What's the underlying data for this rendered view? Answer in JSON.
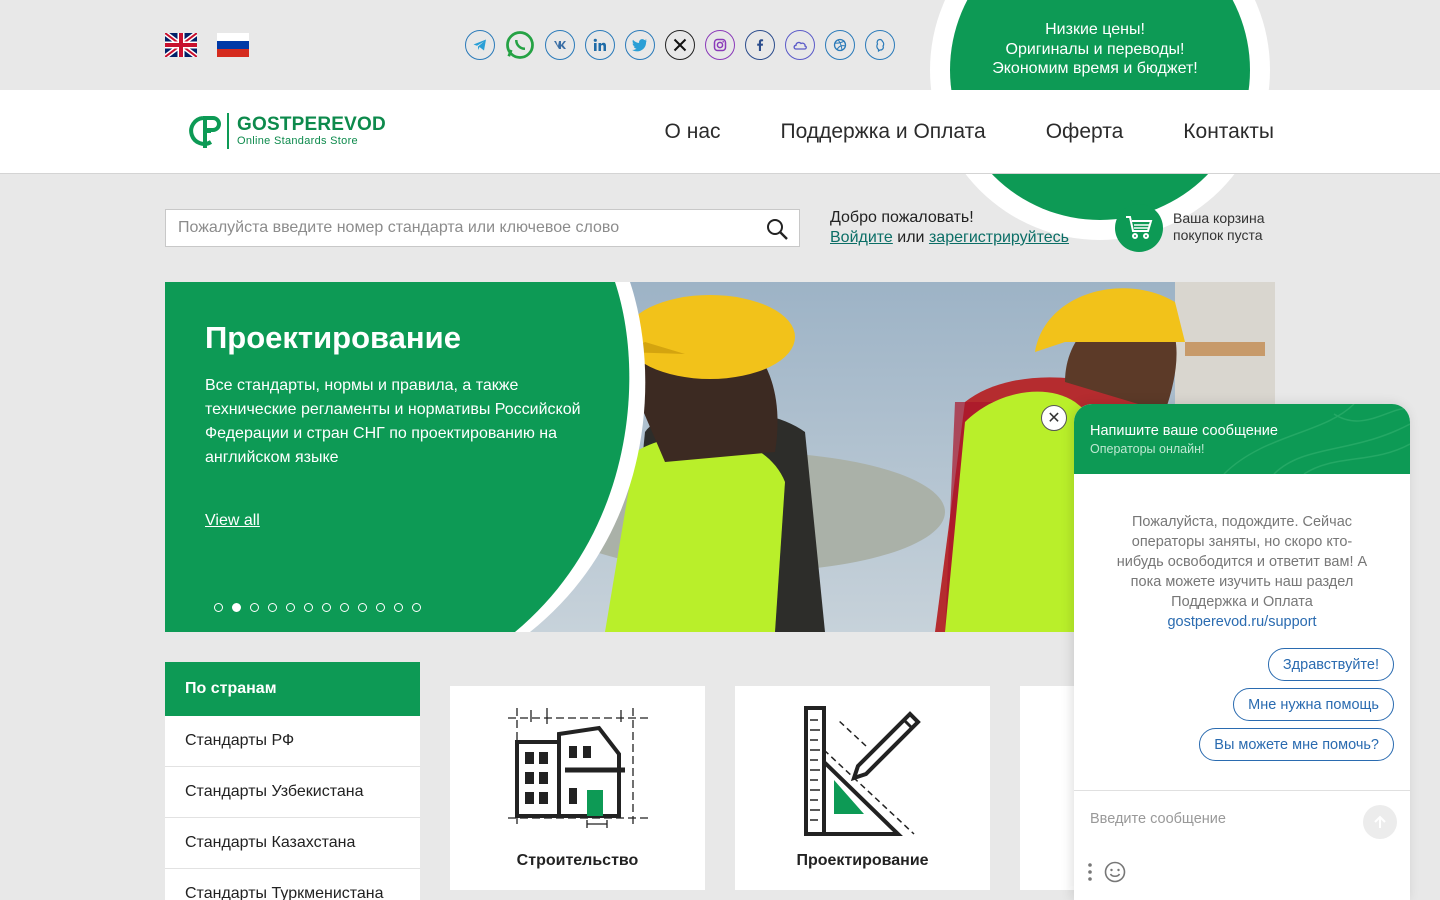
{
  "topbar": {
    "languages": [
      "English",
      "Русский"
    ],
    "socials": [
      "telegram",
      "whatsapp",
      "vk",
      "linkedin",
      "twitter",
      "x",
      "instagram",
      "facebook",
      "cloud",
      "dribbble",
      "messenger"
    ],
    "promo": {
      "line1": "Низкие цены!",
      "line2": "Оригиналы и переводы!",
      "line3": "Экономим время и бюджет!"
    }
  },
  "header": {
    "logo_name": "GOSTPEREVOD",
    "logo_sub": "Online Standards Store",
    "nav": [
      "О нас",
      "Поддержка и Оплата",
      "Оферта",
      "Контакты"
    ]
  },
  "search": {
    "placeholder": "Пожалуйста введите номер стандарта или ключевое слово",
    "value": ""
  },
  "account": {
    "welcome": "Добро пожаловать!",
    "login": "Войдите",
    "or": "или",
    "register": "зарегистрируйтесь"
  },
  "cart": {
    "line1": "Ваша корзина",
    "line2": "покупок пуста"
  },
  "hero": {
    "title": "Проектирование",
    "description": "Все стандарты, нормы и правила, а также технические регламенты и нормативы Российской Федерации и стран СНГ по проектированию на английском языке",
    "link": "View all",
    "slides_total": 12,
    "active_slide": 2
  },
  "sidebar": {
    "heading": "По странам",
    "items": [
      "Стандарты РФ",
      "Стандарты Узбекистана",
      "Стандарты Казахстана",
      "Стандарты Туркменистана"
    ]
  },
  "categories": [
    {
      "label": "Строительство",
      "icon": "building-plan-icon"
    },
    {
      "label": "Проектирование",
      "icon": "drafting-tools-icon"
    }
  ],
  "chat": {
    "title": "Напишите ваше сообщение",
    "status": "Операторы онлайн!",
    "message": "Пожалуйста, подождите. Сейчас операторы заняты, но скоро кто-нибудь освободится и ответит вам! А пока можете изучить наш раздел Поддержка и Оплата",
    "link": "gostperevod.ru/support",
    "quick_replies": [
      "Здравствуйте!",
      "Мне нужна помощь",
      "Вы можете мне помочь?"
    ],
    "input_placeholder": "Введите сообщение"
  },
  "colors": {
    "brand_green": "#0d9a55",
    "link_teal": "#0b6e66",
    "chat_blue": "#2a6bb0"
  }
}
